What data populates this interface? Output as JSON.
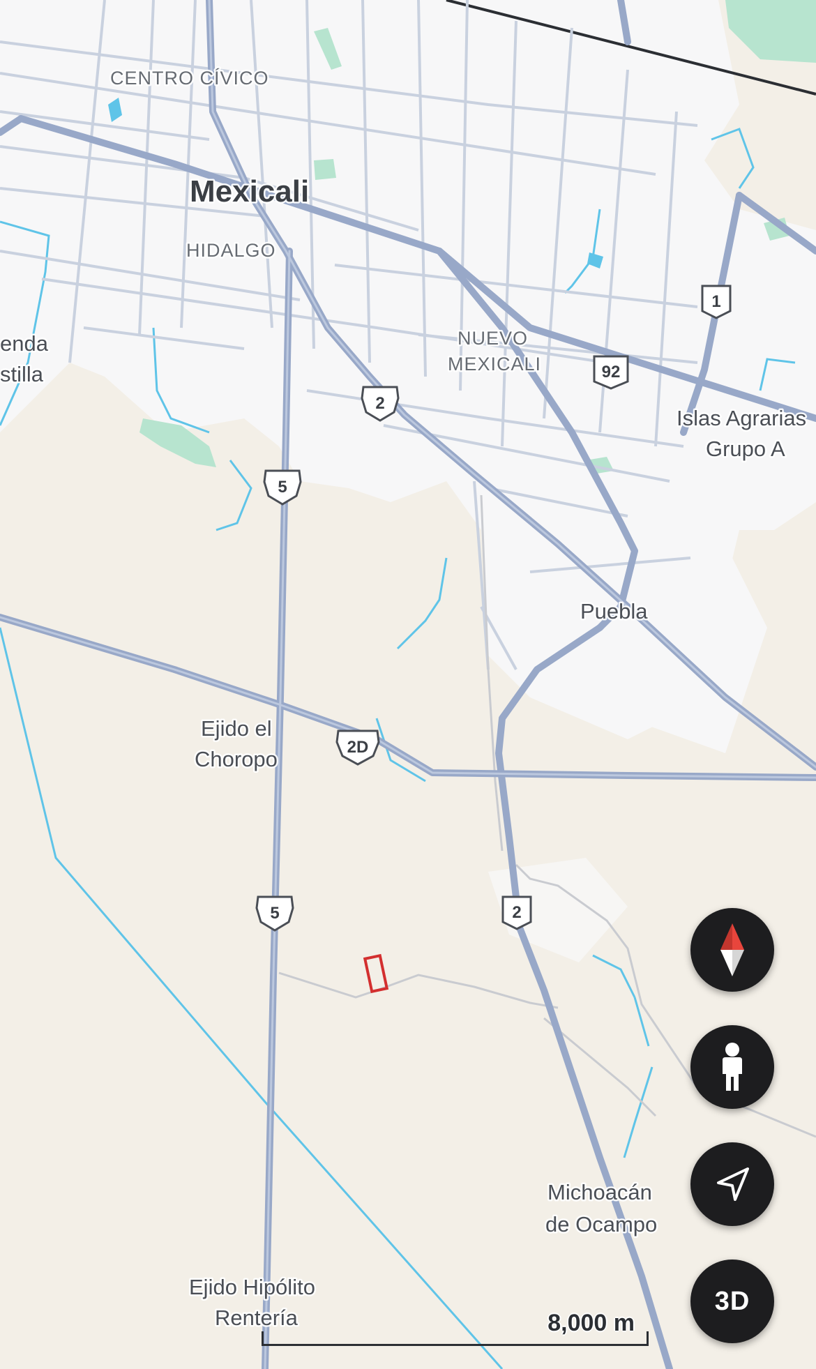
{
  "map": {
    "labels": {
      "city": "Mexicali",
      "centro_civico": "CENTRO CÍVICO",
      "hidalgo": "HIDALGO",
      "nuevo_mexicali_1": "NUEVO",
      "nuevo_mexicali_2": "MEXICALI",
      "hacienda_1": "enda",
      "hacienda_2": "stilla",
      "islas_1": "Islas Agrarias",
      "islas_2": "Grupo A",
      "puebla": "Puebla",
      "choropo_1": "Ejido el",
      "choropo_2": "Choropo",
      "michoacan_1": "Michoacán",
      "michoacan_2": "de Ocampo",
      "renteria_1": "Ejido Hipólito",
      "renteria_2": "Rentería"
    },
    "shields": {
      "s5_upper": "5",
      "s5_lower": "5",
      "s2_upper": "2",
      "s2_lower": "2",
      "s2d": "2D",
      "s92": "92",
      "s1": "1"
    },
    "colors": {
      "land": "#f3efe7",
      "urban": "#f7f7f8",
      "highway": "#98a8c8",
      "street": "#c9d1df",
      "water": "#5fc4e8",
      "park": "#b7e4cf",
      "marker": "#d32f2f"
    }
  },
  "controls": {
    "compass_icon": "compass-icon",
    "streetview_icon": "pegman-icon",
    "locate_icon": "navigation-arrow-icon",
    "view_3d": "3D"
  },
  "scale": {
    "label": "8,000 m"
  }
}
